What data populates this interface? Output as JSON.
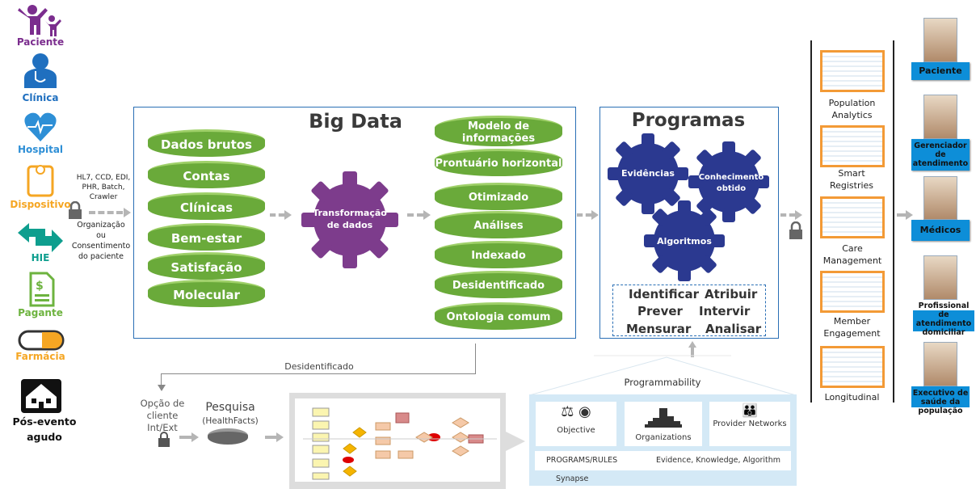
{
  "sources": [
    {
      "label": "Paciente",
      "color": "#7B2D8E",
      "icon": "family-icon"
    },
    {
      "label": "Clínica",
      "color": "#1F6FBF",
      "icon": "doctor-icon"
    },
    {
      "label": "Hospital",
      "color": "#2E8FD6",
      "icon": "heart-pulse-icon"
    },
    {
      "label": "Dispositivo",
      "color": "#F5A623",
      "icon": "scale-device-icon"
    },
    {
      "label": "HIE",
      "color": "#0E9E8E",
      "icon": "exchange-arrows-icon"
    },
    {
      "label": "Pagante",
      "color": "#6DB33F",
      "icon": "invoice-dollar-icon"
    },
    {
      "label": "Farmácia",
      "color": "#F5A623",
      "icon": "pill-icon"
    },
    {
      "label": "Pós-evento agudo",
      "color": "#111111",
      "icon": "house-icon"
    }
  ],
  "ingest": {
    "formats": "HL7, CCD, EDI, PHR, Batch, Crawler",
    "consent": "Organização ou Consentimento do paciente"
  },
  "bigdata": {
    "title": "Big Data",
    "raw": [
      "Dados brutos",
      "Contas",
      "Clínicas",
      "Bem-estar",
      "Satisfação",
      "Molecular"
    ],
    "transform": "Transformação de dados",
    "model": [
      "Modelo de informações",
      "Prontuário horizontal",
      "Otimizado",
      "Análises",
      "Indexado",
      "Desidentificado",
      "Ontologia comum"
    ]
  },
  "programs": {
    "title": "Programas",
    "gears": [
      "Evidências",
      "Conhecimento obtido",
      "Algoritmos"
    ],
    "verbs": [
      "Identificar",
      "Atribuir",
      "Prever",
      "Intervir",
      "Mensurar",
      "Analisar"
    ]
  },
  "apps": [
    "Population Analytics",
    "Smart Registries",
    "Care Management",
    "Member Engagement",
    "Longitudinal"
  ],
  "roles": [
    "Paciente",
    "Gerenciador de atendimento",
    "Médicos",
    "Profissional de atendimento domiciliar",
    "Executivo de saúde da população"
  ],
  "bottom": {
    "deidentified": "Desidentificado",
    "client_option": "Opção de cliente Int/Ext",
    "research": "Pesquisa",
    "research_sub": "(HealthFacts)"
  },
  "synapse": {
    "title": "Programmability",
    "cells": [
      "Objective",
      "Organizations",
      "Provider Networks"
    ],
    "programs": "PROGRAMS/RULES",
    "ek": "Evidence, Knowledge, Algorithm",
    "name": "Synapse"
  },
  "colors": {
    "border": "#2a6fb5",
    "green": "#6aaa3a",
    "purple": "#7d3c8c",
    "navy": "#2b3990",
    "role": "#0d8ed8",
    "orange": "#f39a36"
  }
}
